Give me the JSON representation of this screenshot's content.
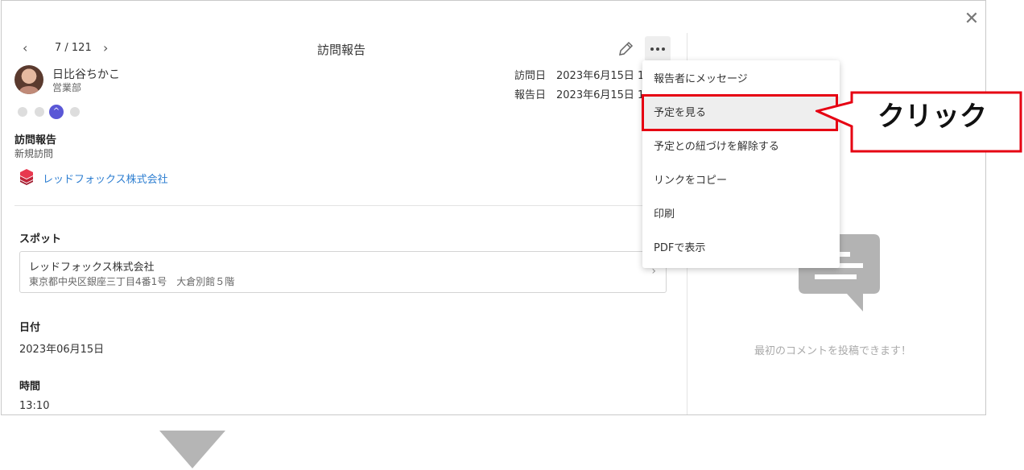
{
  "header": {
    "nav_prev": "‹",
    "nav_next": "›",
    "counter": "7 / 121",
    "title": "訪問報告",
    "close": "✕"
  },
  "user": {
    "name": "日比谷ちかこ",
    "department": "営業部"
  },
  "meta": {
    "visit_label": "訪問日",
    "visit_value": "2023年6月15日 1",
    "report_label": "報告日",
    "report_value": "2023年6月15日 1"
  },
  "report": {
    "type_title": "訪問報告",
    "type_value": "新規訪問",
    "company": "レッドフォックス株式会社"
  },
  "spot": {
    "label": "スポット",
    "name": "レッドフォックス株式会社",
    "address": "東京都中央区銀座三丁目4番1号　大倉別館５階",
    "chevron": "›"
  },
  "date": {
    "label": "日付",
    "value": "2023年06月15日"
  },
  "time": {
    "label": "時間",
    "value": "13:10"
  },
  "menu": {
    "items": [
      {
        "label": "報告者にメッセージ"
      },
      {
        "label": "予定を見る"
      },
      {
        "label": "予定との紐づけを解除する"
      },
      {
        "label": "リンクをコピー"
      },
      {
        "label": "印刷"
      },
      {
        "label": "PDFで表示"
      }
    ]
  },
  "comments": {
    "empty_text": "最初のコメントを投稿できます！"
  },
  "annotation": {
    "callout_text": "クリック",
    "highlight_color": "#e60012"
  },
  "colors": {
    "link": "#2f7fd1",
    "reaction_active": "#5a57d6"
  }
}
